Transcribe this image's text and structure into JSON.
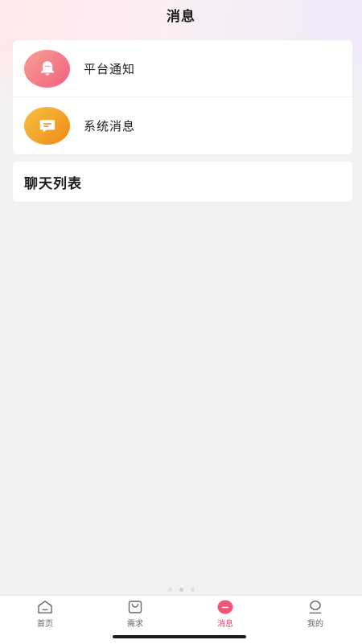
{
  "header": {
    "title": "消息"
  },
  "notifications": [
    {
      "label": "平台通知",
      "icon": "bell-icon",
      "color": "#f2607f"
    },
    {
      "label": "系统消息",
      "icon": "message-icon",
      "color": "#f08a15"
    }
  ],
  "chat_list": {
    "title": "聊天列表"
  },
  "tabbar": {
    "active_color": "#e8456d",
    "items": [
      {
        "label": "首页",
        "icon": "home-icon"
      },
      {
        "label": "需求",
        "icon": "bag-icon"
      },
      {
        "label": "消息",
        "icon": "chat-icon"
      },
      {
        "label": "我的",
        "icon": "user-icon"
      }
    ]
  }
}
